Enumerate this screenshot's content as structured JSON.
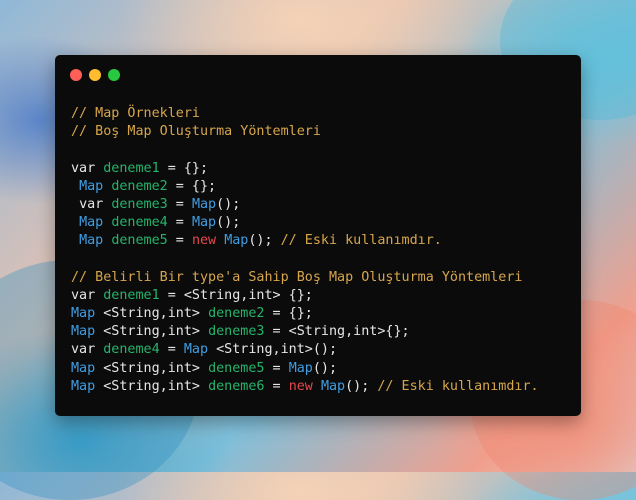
{
  "window": {
    "controls": [
      "close",
      "minimize",
      "zoom"
    ],
    "colors": {
      "close": "#ff5f57",
      "minimize": "#febc2e",
      "zoom": "#28c840",
      "background": "#0b0b0b"
    }
  },
  "code": {
    "colors": {
      "comment": "#d7a64c",
      "identifier": "#27b36b",
      "type": "#3f9ee4",
      "new": "#e5484d",
      "plain": "#e6e6e6"
    },
    "lines": [
      [
        {
          "t": "cmt",
          "v": "// Map Örnekleri"
        }
      ],
      [
        {
          "t": "cmt",
          "v": "// Boş Map Oluşturma Yöntemleri"
        }
      ],
      [],
      [
        {
          "t": "kw",
          "v": "var "
        },
        {
          "t": "id",
          "v": "deneme1"
        },
        {
          "t": "txt",
          "v": " = {};"
        }
      ],
      [
        {
          "t": "txt",
          "v": " "
        },
        {
          "t": "type",
          "v": "Map"
        },
        {
          "t": "txt",
          "v": " "
        },
        {
          "t": "id",
          "v": "deneme2"
        },
        {
          "t": "txt",
          "v": " = {};"
        }
      ],
      [
        {
          "t": "txt",
          "v": " "
        },
        {
          "t": "kw",
          "v": "var "
        },
        {
          "t": "id",
          "v": "deneme3"
        },
        {
          "t": "txt",
          "v": " = "
        },
        {
          "t": "type",
          "v": "Map"
        },
        {
          "t": "txt",
          "v": "();"
        }
      ],
      [
        {
          "t": "txt",
          "v": " "
        },
        {
          "t": "type",
          "v": "Map"
        },
        {
          "t": "txt",
          "v": " "
        },
        {
          "t": "id",
          "v": "deneme4"
        },
        {
          "t": "txt",
          "v": " = "
        },
        {
          "t": "type",
          "v": "Map"
        },
        {
          "t": "txt",
          "v": "();"
        }
      ],
      [
        {
          "t": "txt",
          "v": " "
        },
        {
          "t": "type",
          "v": "Map"
        },
        {
          "t": "txt",
          "v": " "
        },
        {
          "t": "id",
          "v": "deneme5"
        },
        {
          "t": "txt",
          "v": " = "
        },
        {
          "t": "new",
          "v": "new"
        },
        {
          "t": "txt",
          "v": " "
        },
        {
          "t": "type",
          "v": "Map"
        },
        {
          "t": "txt",
          "v": "(); "
        },
        {
          "t": "cmt",
          "v": "// Eski kullanımdır."
        }
      ],
      [],
      [
        {
          "t": "cmt",
          "v": "// Belirli Bir type'a Sahip Boş Map Oluşturma Yöntemleri"
        }
      ],
      [
        {
          "t": "kw",
          "v": "var "
        },
        {
          "t": "id",
          "v": "deneme1"
        },
        {
          "t": "txt",
          "v": " = <String,int> {};"
        }
      ],
      [
        {
          "t": "type",
          "v": "Map"
        },
        {
          "t": "txt",
          "v": " <String,int> "
        },
        {
          "t": "id",
          "v": "deneme2"
        },
        {
          "t": "txt",
          "v": " = {};"
        }
      ],
      [
        {
          "t": "type",
          "v": "Map"
        },
        {
          "t": "txt",
          "v": " <String,int> "
        },
        {
          "t": "id",
          "v": "deneme3"
        },
        {
          "t": "txt",
          "v": " = <String,int>{};"
        }
      ],
      [
        {
          "t": "kw",
          "v": "var "
        },
        {
          "t": "id",
          "v": "deneme4"
        },
        {
          "t": "txt",
          "v": " = "
        },
        {
          "t": "type",
          "v": "Map"
        },
        {
          "t": "txt",
          "v": " <String,int>();"
        }
      ],
      [
        {
          "t": "type",
          "v": "Map"
        },
        {
          "t": "txt",
          "v": " <String,int> "
        },
        {
          "t": "id",
          "v": "deneme5"
        },
        {
          "t": "txt",
          "v": " = "
        },
        {
          "t": "type",
          "v": "Map"
        },
        {
          "t": "txt",
          "v": "();"
        }
      ],
      [
        {
          "t": "type",
          "v": "Map"
        },
        {
          "t": "txt",
          "v": " <String,int> "
        },
        {
          "t": "id",
          "v": "deneme6"
        },
        {
          "t": "txt",
          "v": " = "
        },
        {
          "t": "new",
          "v": "new"
        },
        {
          "t": "txt",
          "v": " "
        },
        {
          "t": "type",
          "v": "Map"
        },
        {
          "t": "txt",
          "v": "(); "
        },
        {
          "t": "cmt",
          "v": "// Eski kullanımdır."
        }
      ]
    ]
  }
}
